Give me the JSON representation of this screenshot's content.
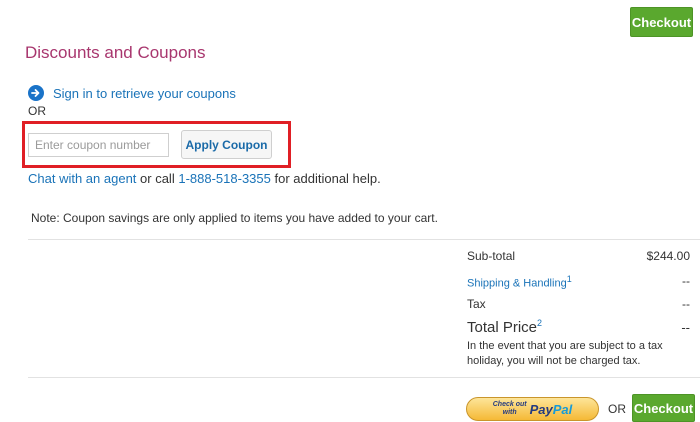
{
  "header": {
    "checkout_label": "Checkout"
  },
  "discounts": {
    "title": "Discounts and Coupons",
    "signin_link": "Sign in to retrieve your coupons",
    "or_text": "OR",
    "coupon_input": {
      "value": "",
      "placeholder": "Enter coupon number"
    },
    "apply_button": "Apply Coupon",
    "help": {
      "chat_link": "Chat with an agent",
      "or_call": "or call",
      "phone_link": "1-888-518-3355",
      "suffix": "for additional help."
    },
    "note": "Note: Coupon savings are only applied to items you have added to your cart."
  },
  "summary": {
    "subtotal_label": "Sub-total",
    "subtotal_value": "$244.00",
    "shipping_label": "Shipping & Handling",
    "shipping_footnote": "1",
    "shipping_value": "--",
    "tax_label": "Tax",
    "tax_value": "--",
    "total_label": "Total Price",
    "total_footnote": "2",
    "total_value": "--",
    "tax_holiday_note": "In the event that you are subject to a tax holiday, you will not be charged tax."
  },
  "footer": {
    "paypal_prefix_line1": "Check out",
    "paypal_prefix_line2": "with",
    "paypal_pay": "Pay",
    "paypal_pal": "Pal",
    "or_text": "OR",
    "checkout_label": "Checkout"
  },
  "colors": {
    "checkout_green": "#5aa82e",
    "title_magenta": "#a8366e",
    "link_blue": "#1a73b8",
    "highlight_red": "#e01f25"
  },
  "icons": {
    "signin": "arrow-circle-right-icon"
  }
}
